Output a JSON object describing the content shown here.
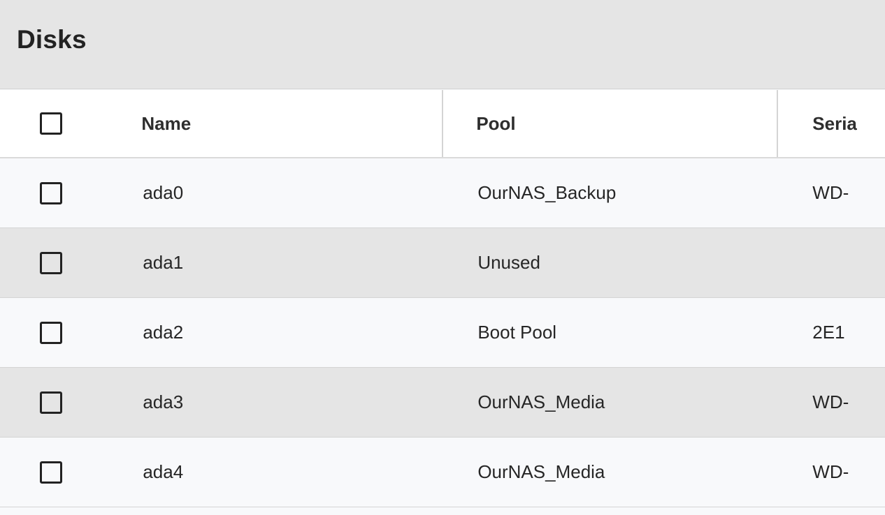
{
  "page": {
    "title": "Disks"
  },
  "table": {
    "columns": [
      {
        "label": "Name"
      },
      {
        "label": "Pool"
      },
      {
        "label": "Seria"
      }
    ],
    "rows": [
      {
        "name": "ada0",
        "pool": "OurNAS_Backup",
        "serial": "WD-"
      },
      {
        "name": "ada1",
        "pool": "Unused",
        "serial": ""
      },
      {
        "name": "ada2",
        "pool": "Boot Pool",
        "serial": "2E1"
      },
      {
        "name": "ada3",
        "pool": "OurNAS_Media",
        "serial": "WD-"
      },
      {
        "name": "ada4",
        "pool": "OurNAS_Media",
        "serial": "WD-"
      }
    ]
  }
}
